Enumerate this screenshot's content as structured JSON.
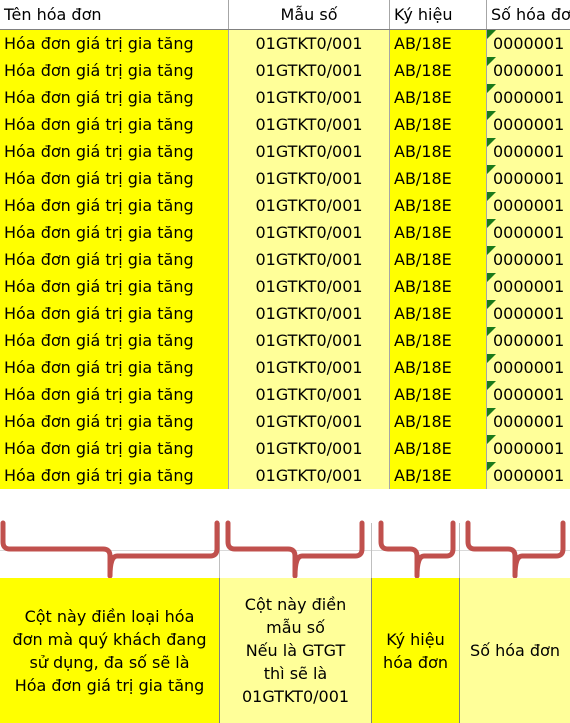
{
  "sheet": {
    "columns": [
      {
        "key": "ten_hoa_don",
        "header": "Tên hóa đơn"
      },
      {
        "key": "mau_so",
        "header": "Mẫu số"
      },
      {
        "key": "ky_hieu",
        "header": "Ký hiệu"
      },
      {
        "key": "so_hoa_don",
        "header": "Số hóa đơn"
      }
    ],
    "row_count": 17,
    "row_values": {
      "ten_hoa_don": "Hóa đơn giá trị gia tăng",
      "mau_so": "01GTKT0/001",
      "ky_hieu": "AB/18E",
      "so_hoa_don": "0000001"
    },
    "rows": [
      {
        "ten_hoa_don": "Hóa đơn giá trị gia tăng",
        "mau_so": "01GTKT0/001",
        "ky_hieu": "AB/18E",
        "so_hoa_don": "0000001"
      },
      {
        "ten_hoa_don": "Hóa đơn giá trị gia tăng",
        "mau_so": "01GTKT0/001",
        "ky_hieu": "AB/18E",
        "so_hoa_don": "0000001"
      },
      {
        "ten_hoa_don": "Hóa đơn giá trị gia tăng",
        "mau_so": "01GTKT0/001",
        "ky_hieu": "AB/18E",
        "so_hoa_don": "0000001"
      },
      {
        "ten_hoa_don": "Hóa đơn giá trị gia tăng",
        "mau_so": "01GTKT0/001",
        "ky_hieu": "AB/18E",
        "so_hoa_don": "0000001"
      },
      {
        "ten_hoa_don": "Hóa đơn giá trị gia tăng",
        "mau_so": "01GTKT0/001",
        "ky_hieu": "AB/18E",
        "so_hoa_don": "0000001"
      },
      {
        "ten_hoa_don": "Hóa đơn giá trị gia tăng",
        "mau_so": "01GTKT0/001",
        "ky_hieu": "AB/18E",
        "so_hoa_don": "0000001"
      },
      {
        "ten_hoa_don": "Hóa đơn giá trị gia tăng",
        "mau_so": "01GTKT0/001",
        "ky_hieu": "AB/18E",
        "so_hoa_don": "0000001"
      },
      {
        "ten_hoa_don": "Hóa đơn giá trị gia tăng",
        "mau_so": "01GTKT0/001",
        "ky_hieu": "AB/18E",
        "so_hoa_don": "0000001"
      },
      {
        "ten_hoa_don": "Hóa đơn giá trị gia tăng",
        "mau_so": "01GTKT0/001",
        "ky_hieu": "AB/18E",
        "so_hoa_don": "0000001"
      },
      {
        "ten_hoa_don": "Hóa đơn giá trị gia tăng",
        "mau_so": "01GTKT0/001",
        "ky_hieu": "AB/18E",
        "so_hoa_don": "0000001"
      },
      {
        "ten_hoa_don": "Hóa đơn giá trị gia tăng",
        "mau_so": "01GTKT0/001",
        "ky_hieu": "AB/18E",
        "so_hoa_don": "0000001"
      },
      {
        "ten_hoa_don": "Hóa đơn giá trị gia tăng",
        "mau_so": "01GTKT0/001",
        "ky_hieu": "AB/18E",
        "so_hoa_don": "0000001"
      },
      {
        "ten_hoa_don": "Hóa đơn giá trị gia tăng",
        "mau_so": "01GTKT0/001",
        "ky_hieu": "AB/18E",
        "so_hoa_don": "0000001"
      },
      {
        "ten_hoa_don": "Hóa đơn giá trị gia tăng",
        "mau_so": "01GTKT0/001",
        "ky_hieu": "AB/18E",
        "so_hoa_don": "0000001"
      },
      {
        "ten_hoa_don": "Hóa đơn giá trị gia tăng",
        "mau_so": "01GTKT0/001",
        "ky_hieu": "AB/18E",
        "so_hoa_don": "0000001"
      },
      {
        "ten_hoa_don": "Hóa đơn giá trị gia tăng",
        "mau_so": "01GTKT0/001",
        "ky_hieu": "AB/18E",
        "so_hoa_don": "0000001"
      },
      {
        "ten_hoa_don": "Hóa đơn giá trị gia tăng",
        "mau_so": "01GTKT0/001",
        "ky_hieu": "AB/18E",
        "so_hoa_don": "0000001"
      }
    ]
  },
  "annotations": {
    "brace_color": "#c0504d",
    "error_marker_color": "#1a7a1a",
    "error_marker_name": "green-triangle-error-indicator",
    "notes": [
      {
        "column": "ten_hoa_don",
        "lines": [
          "Cột này điền loại hóa",
          "đơn mà quý khách đang",
          "sử dụng, đa số sẽ là",
          "Hóa đơn giá trị gia tăng"
        ]
      },
      {
        "column": "mau_so",
        "lines": [
          "Cột này điền",
          "mẫu số",
          "Nếu là GTGT",
          "thì sẽ là",
          "01GTKT0/001"
        ]
      },
      {
        "column": "ky_hieu",
        "lines": [
          "Ký hiệu",
          "hóa đơn"
        ]
      },
      {
        "column": "so_hoa_don",
        "lines": [
          "Số hóa đơn"
        ]
      }
    ]
  },
  "colors": {
    "highlight_strong": "#FFFF00",
    "highlight_light": "#FFFF99",
    "grid_line": "#A6A6A6",
    "text": "#000000",
    "brace": "#C0504D"
  }
}
